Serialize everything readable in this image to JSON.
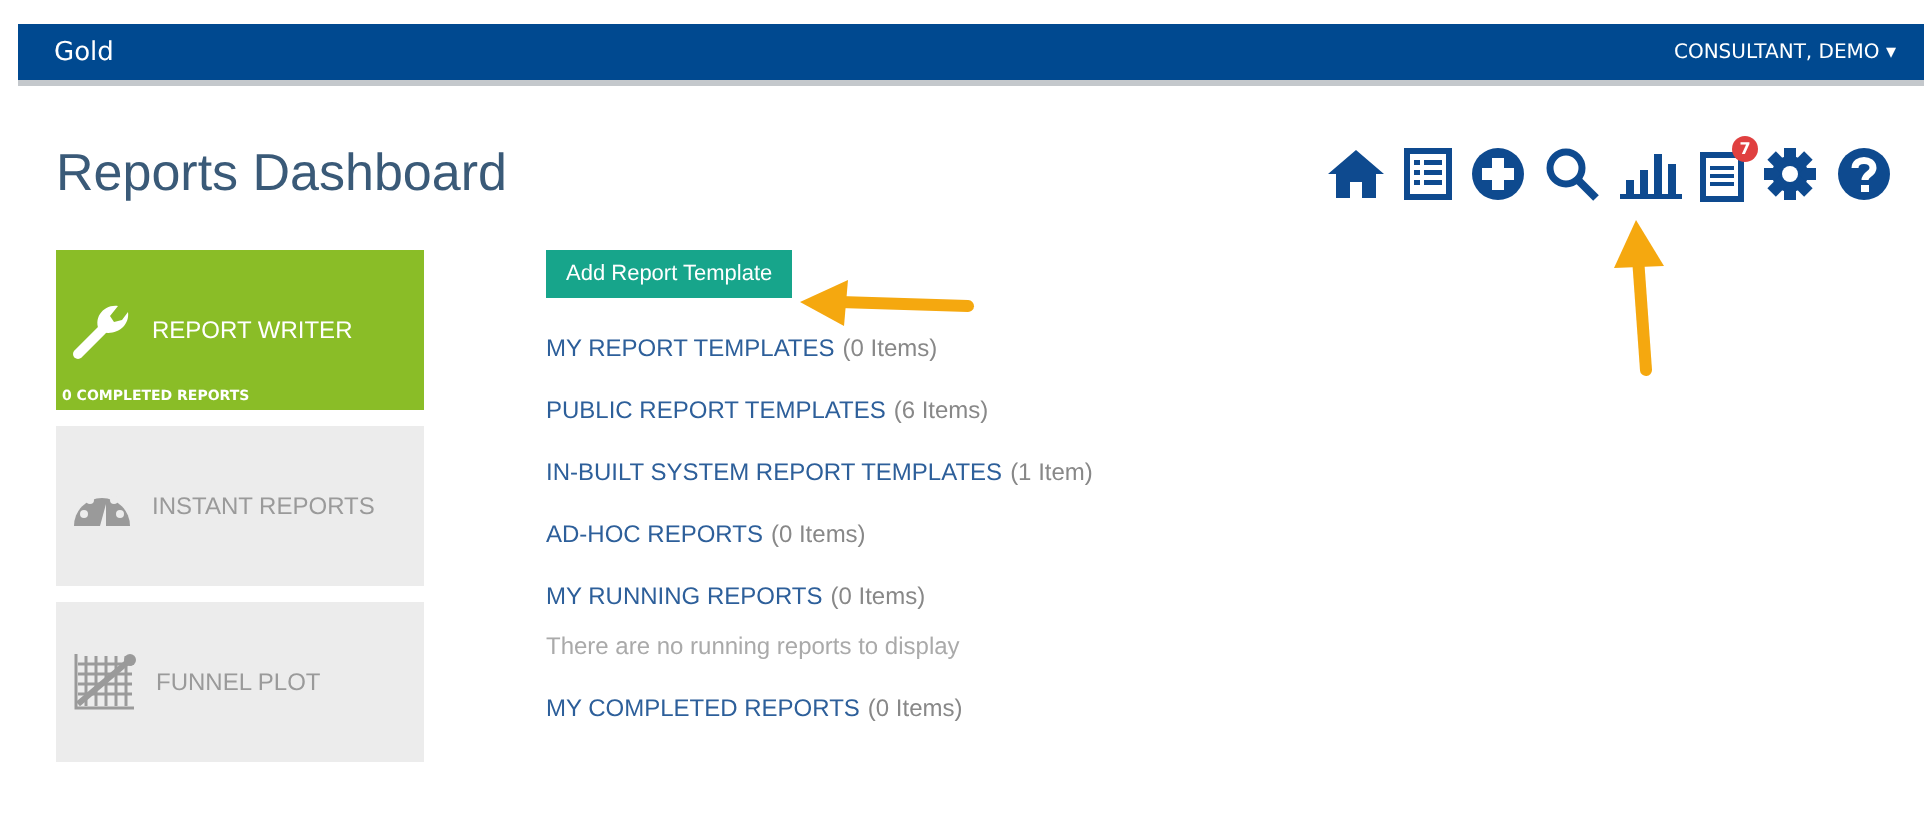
{
  "topbar": {
    "brand": "Gold",
    "user": "CONSULTANT, DEMO ▾"
  },
  "title": "Reports Dashboard",
  "toolbar": [
    {
      "kind": "home"
    },
    {
      "kind": "list"
    },
    {
      "kind": "add"
    },
    {
      "kind": "search"
    },
    {
      "kind": "chart"
    },
    {
      "kind": "notes",
      "badge": "7"
    },
    {
      "kind": "settings"
    },
    {
      "kind": "help"
    }
  ],
  "tiles": [
    {
      "kind": "wrench",
      "label": "REPORT WRITER",
      "active": true,
      "footer": "0 COMPLETED REPORTS"
    },
    {
      "kind": "gauge",
      "label": "INSTANT REPORTS",
      "active": false
    },
    {
      "kind": "plot",
      "label": "FUNNEL PLOT",
      "active": false
    }
  ],
  "add_button": "Add Report Template",
  "sections": [
    {
      "link": "MY REPORT TEMPLATES",
      "count": "(0 Items)"
    },
    {
      "link": "PUBLIC REPORT TEMPLATES",
      "count": "(6 Items)"
    },
    {
      "link": "IN-BUILT SYSTEM REPORT TEMPLATES",
      "count": "(1 Item)"
    },
    {
      "link": "AD-HOC REPORTS",
      "count": "(0 Items)"
    },
    {
      "link": "MY RUNNING REPORTS",
      "count": "(0 Items)",
      "note": "There are no running reports to display"
    },
    {
      "link": "MY COMPLETED REPORTS",
      "count": "(0 Items)"
    }
  ]
}
